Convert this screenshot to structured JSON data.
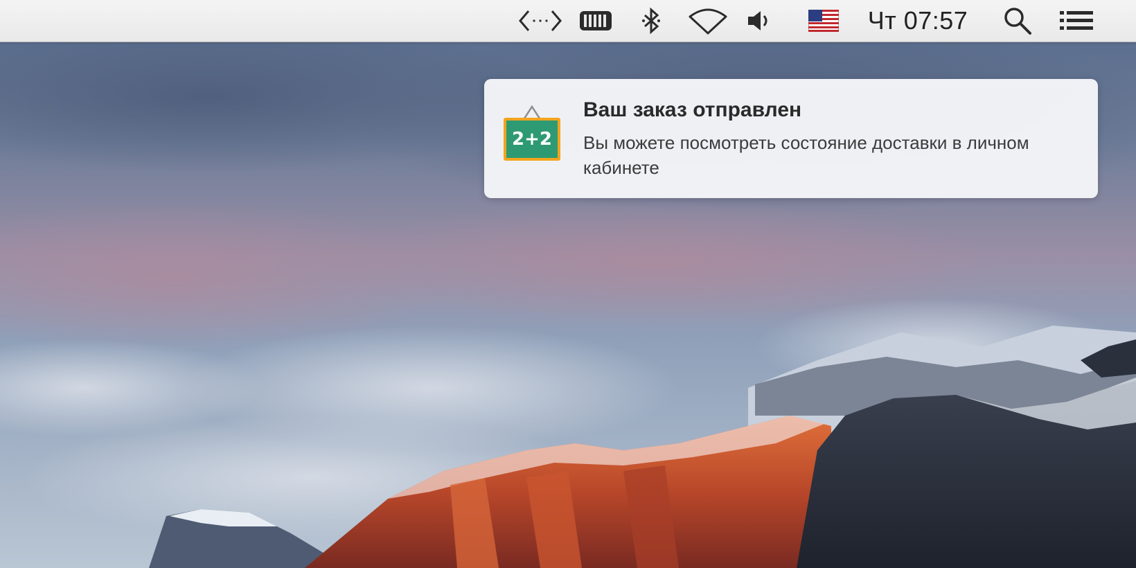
{
  "menubar": {
    "icons": [
      "code-brackets-icon",
      "battery-icon",
      "bluetooth-icon",
      "wifi-icon",
      "volume-icon",
      "us-flag-icon",
      "search-icon",
      "list-icon"
    ],
    "clock": "Чт 07:57"
  },
  "notification": {
    "app_icon_label": "2+2",
    "title": "Ваш заказ отправлен",
    "body": "Вы можете посмотреть состояние доставки в личном кабинете"
  },
  "colors": {
    "icon_board": "#2e9a74",
    "icon_border": "#f3a41c"
  }
}
